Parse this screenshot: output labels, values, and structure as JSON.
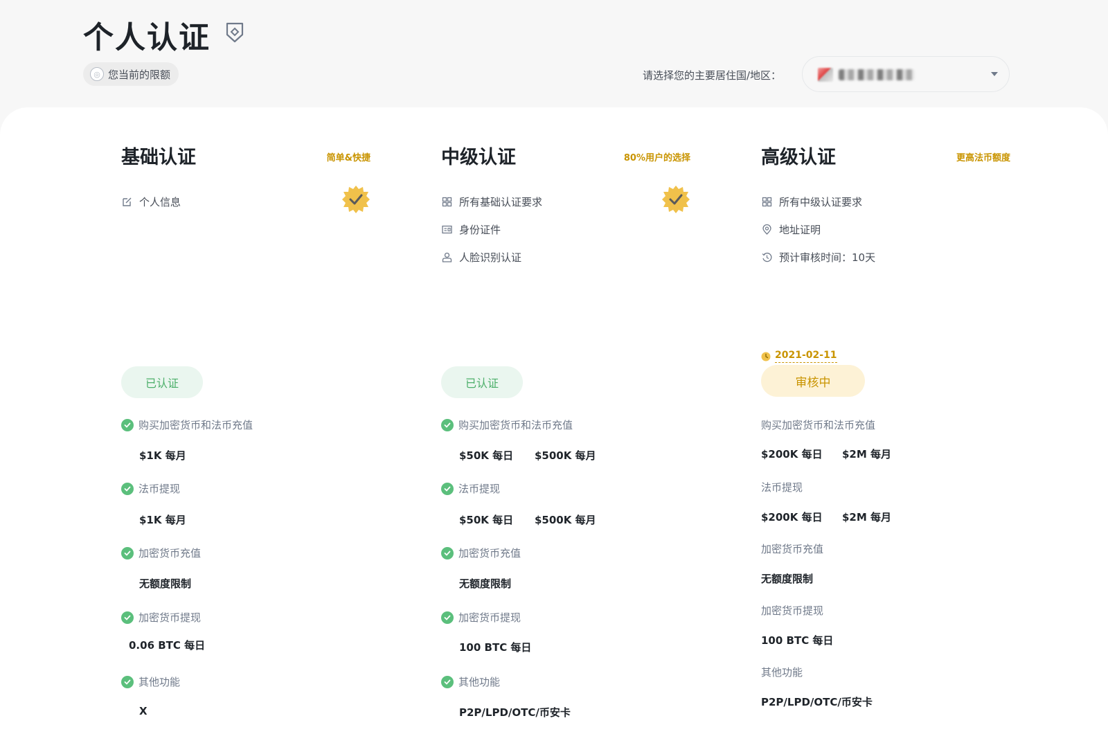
{
  "header": {
    "title": "个人认证",
    "limit_chip": "您当前的限额",
    "region_label": "请选择您的主要居住国/地区："
  },
  "tiers": [
    {
      "title": "基础认证",
      "tag": "简单&快捷",
      "verified_badge": true,
      "requirements": [
        {
          "icon": "edit-icon",
          "label": "个人信息"
        }
      ],
      "status": "已认证",
      "status_type": "verified",
      "features": [
        {
          "label": "购买加密货币和法币充值",
          "checked": true,
          "values": [
            "$1K 每月"
          ]
        },
        {
          "label": "法币提现",
          "checked": true,
          "values": [
            "$1K 每月"
          ]
        },
        {
          "label": "加密货币充值",
          "checked": true,
          "values": [
            "无额度限制"
          ]
        },
        {
          "label": "加密货币提现",
          "checked": true,
          "values": [
            "0.06 BTC 每日"
          ]
        },
        {
          "label": "其他功能",
          "checked": true,
          "values": [
            "X"
          ]
        }
      ]
    },
    {
      "title": "中级认证",
      "tag": "80%用户的选择",
      "verified_badge": true,
      "requirements": [
        {
          "icon": "grid-icon",
          "label": "所有基础认证要求"
        },
        {
          "icon": "id-card-icon",
          "label": "身份证件"
        },
        {
          "icon": "user-icon",
          "label": "人脸识别认证"
        }
      ],
      "status": "已认证",
      "status_type": "verified",
      "features": [
        {
          "label": "购买加密货币和法币充值",
          "checked": true,
          "values": [
            "$50K 每日",
            "$500K 每月"
          ]
        },
        {
          "label": "法币提现",
          "checked": true,
          "values": [
            "$50K 每日",
            "$500K 每月"
          ]
        },
        {
          "label": "加密货币充值",
          "checked": true,
          "values": [
            "无额度限制"
          ]
        },
        {
          "label": "加密货币提现",
          "checked": true,
          "values": [
            "100 BTC 每日"
          ]
        },
        {
          "label": "其他功能",
          "checked": true,
          "values": [
            "P2P/LPD/OTC/币安卡"
          ]
        }
      ]
    },
    {
      "title": "高级认证",
      "tag": "更高法币额度",
      "verified_badge": false,
      "requirements": [
        {
          "icon": "grid-icon",
          "label": "所有中级认证要求"
        },
        {
          "icon": "location-pin-icon",
          "label": "地址证明"
        },
        {
          "icon": "history-icon",
          "label": "预计审核时间：10天"
        }
      ],
      "review_date": "2021-02-11",
      "status": "审核中",
      "status_type": "review",
      "features": [
        {
          "label": "购买加密货币和法币充值",
          "checked": false,
          "values": [
            "$200K 每日",
            "$2M 每月"
          ]
        },
        {
          "label": "法币提现",
          "checked": false,
          "values": [
            "$200K 每日",
            "$2M 每月"
          ]
        },
        {
          "label": "加密货币充值",
          "checked": false,
          "values": [
            "无额度限制"
          ]
        },
        {
          "label": "加密货币提现",
          "checked": false,
          "values": [
            "100 BTC 每日"
          ]
        },
        {
          "label": "其他功能",
          "checked": false,
          "values": [
            "P2P/LPD/OTC/币安卡"
          ]
        }
      ]
    }
  ],
  "colors": {
    "accent": "#c99400",
    "success": "#5bbf7c",
    "success_bg": "#eaf6ef",
    "review_bg": "#fdf2d6"
  }
}
